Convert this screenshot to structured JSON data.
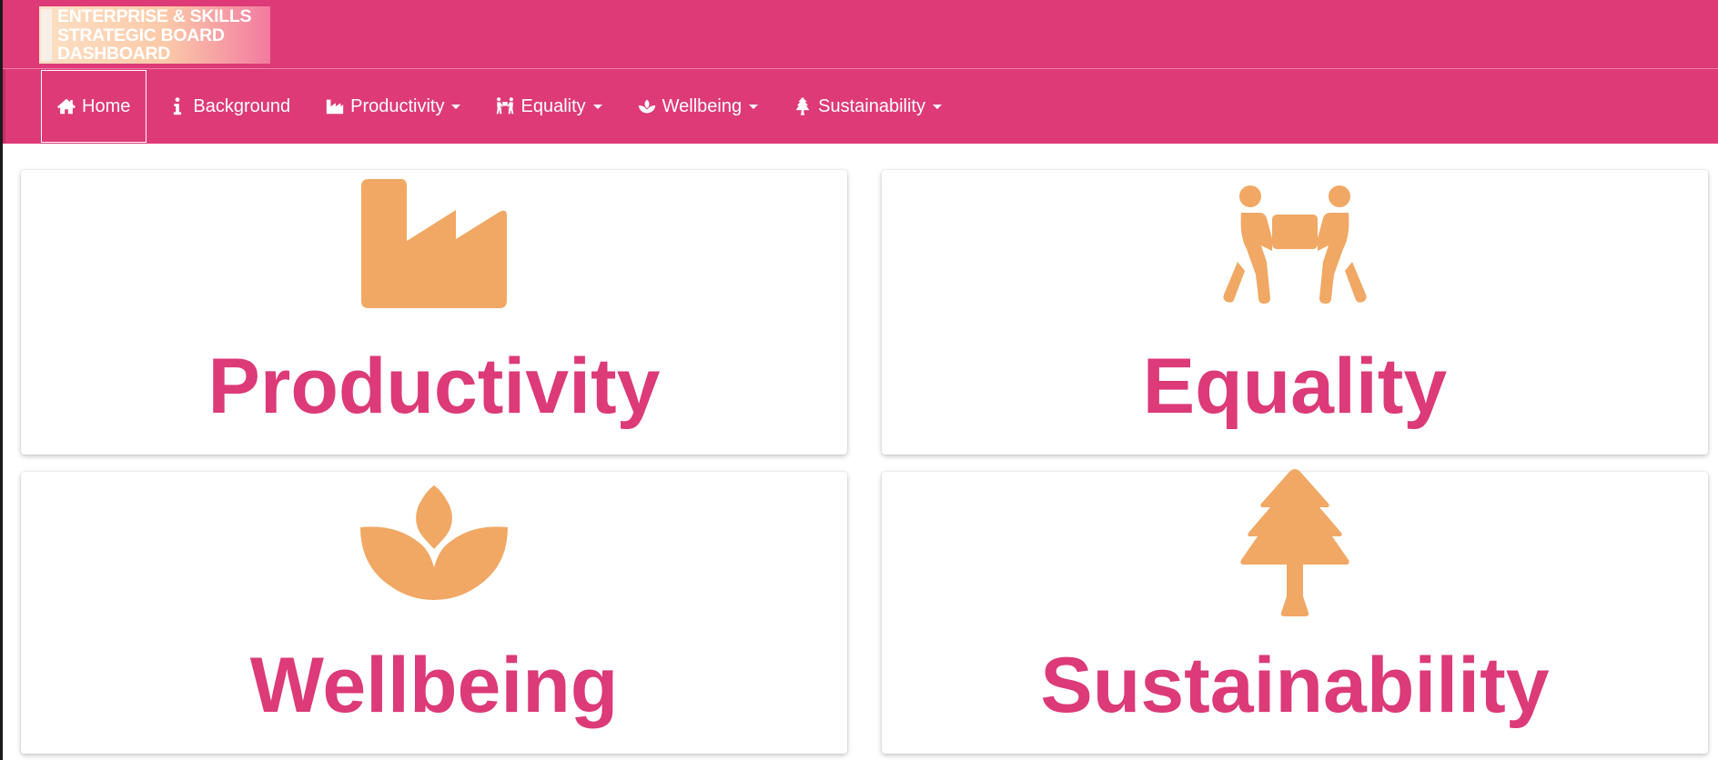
{
  "header": {
    "logo_lines": [
      "ENTERPRISE & SKILLS",
      "STRATEGIC BOARD",
      "DASHBOARD"
    ]
  },
  "nav": {
    "items": [
      {
        "label": "Home",
        "icon": "home-icon",
        "active": true,
        "dropdown": false
      },
      {
        "label": "Background",
        "icon": "info-icon",
        "active": false,
        "dropdown": false
      },
      {
        "label": "Productivity",
        "icon": "industry-icon",
        "active": false,
        "dropdown": true
      },
      {
        "label": "Equality",
        "icon": "people-carry-icon",
        "active": false,
        "dropdown": true
      },
      {
        "label": "Wellbeing",
        "icon": "spa-icon",
        "active": false,
        "dropdown": true
      },
      {
        "label": "Sustainability",
        "icon": "tree-icon",
        "active": false,
        "dropdown": true
      }
    ]
  },
  "cards": [
    {
      "title": "Productivity",
      "icon": "industry-icon"
    },
    {
      "title": "Equality",
      "icon": "people-carry-icon"
    },
    {
      "title": "Wellbeing",
      "icon": "spa-icon"
    },
    {
      "title": "Sustainability",
      "icon": "tree-icon"
    }
  ],
  "colors": {
    "brand_pink": "#de3a78",
    "title_pink": "#dc3a78",
    "icon_orange": "#f0a864"
  }
}
